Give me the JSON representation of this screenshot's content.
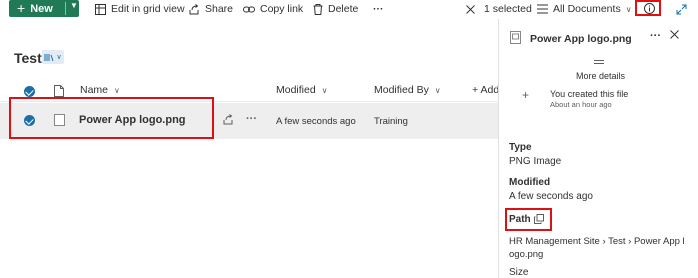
{
  "toolbar": {
    "new_label": "New",
    "edit_grid_label": "Edit in grid view",
    "share_label": "Share",
    "copy_link_label": "Copy link",
    "delete_label": "Delete",
    "more_label": "···",
    "selected_label": "1 selected",
    "view_label": "All Documents"
  },
  "library": {
    "title": "Test"
  },
  "columns": {
    "name": "Name",
    "modified": "Modified",
    "modified_by": "Modified By",
    "add": "+ Add"
  },
  "rows": [
    {
      "name": "Power App  logo.png",
      "modified": "A few seconds ago",
      "modified_by": "Training"
    }
  ],
  "panel": {
    "file_name": "Power App logo.png",
    "more_details": "More details",
    "activity_text": "You created this file",
    "activity_time": "About an hour ago",
    "type_label": "Type",
    "type_value": "PNG Image",
    "modified_label": "Modified",
    "modified_value": "A few seconds ago",
    "path_label": "Path",
    "path_line1": "HR Management Site  ›  Test  ›  Power App l",
    "path_line2": "ogo.png",
    "size_label": "Size"
  },
  "colors": {
    "accent": "#1f7a55",
    "highlight": "#dd1111",
    "check": "#1b6ea8"
  }
}
